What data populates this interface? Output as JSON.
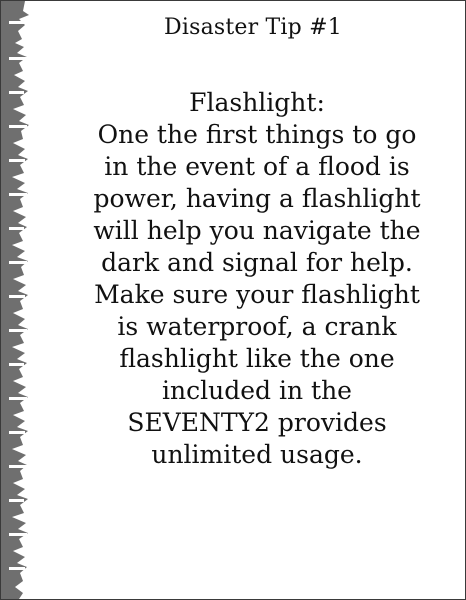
{
  "card": {
    "title": "Disaster Tip #1",
    "lines": [
      "Flashlight:",
      "One the first things to go",
      "in the event of a flood is",
      "power, having a flashlight",
      "will help you navigate the",
      "dark and signal for help.",
      "Make sure your flashlight",
      "is waterproof, a crank",
      "flashlight like the one",
      "included in the",
      "SEVENTY2 provides",
      "unlimited usage."
    ]
  },
  "colors": {
    "edge": "#6f6f6f",
    "text": "#111111",
    "background": "#ffffff"
  }
}
